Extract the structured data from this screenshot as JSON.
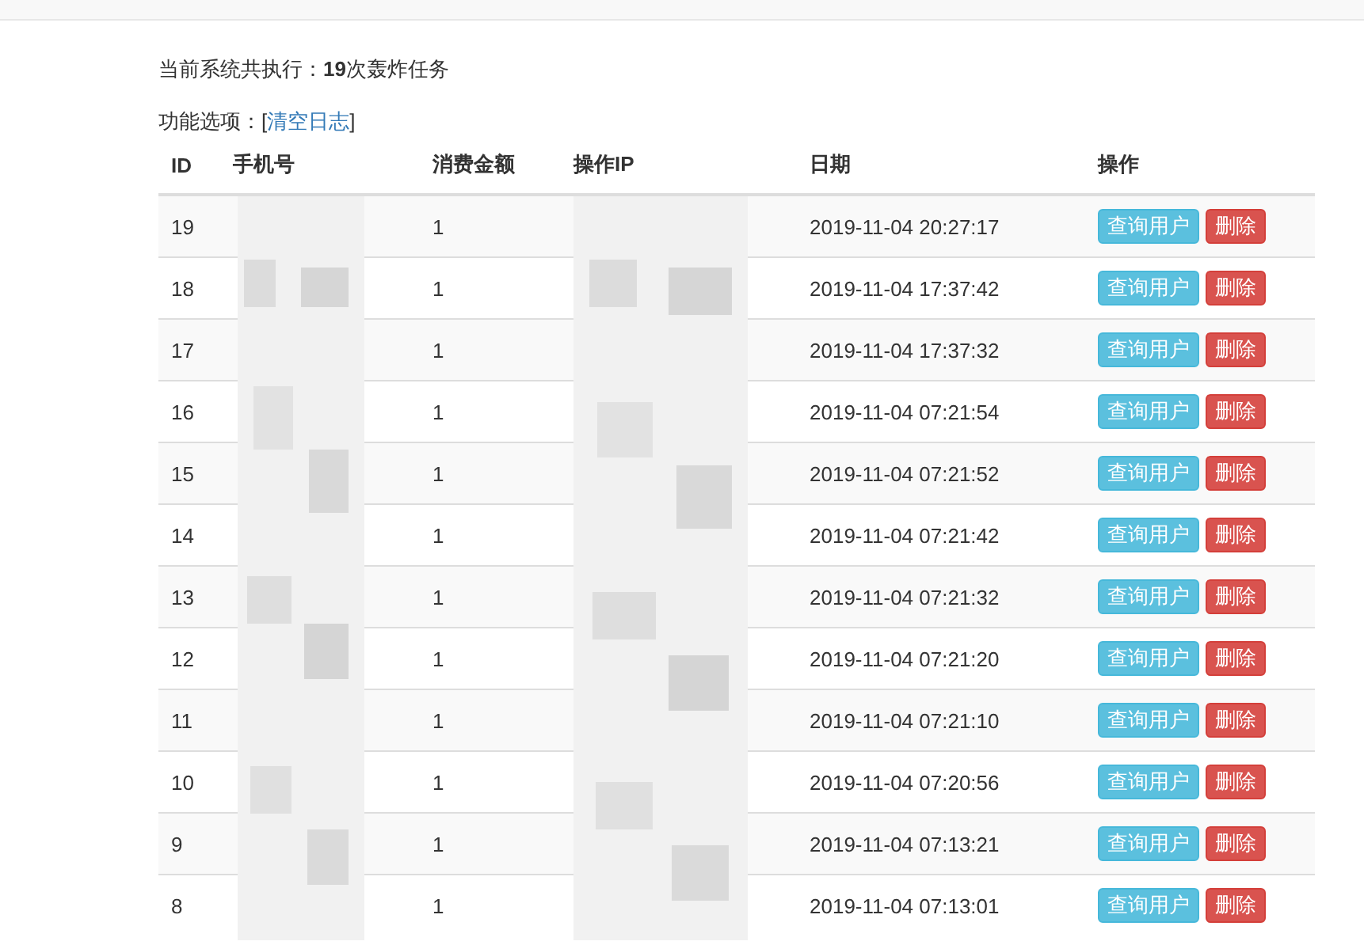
{
  "summary": {
    "prefix": "当前系统共执行：",
    "count": "19",
    "suffix": "次轰炸任务"
  },
  "options": {
    "label": "功能选项：[",
    "link": "清空日志",
    "close": "]"
  },
  "table": {
    "columns": [
      "ID",
      "手机号",
      "消费金额",
      "操作IP",
      "日期",
      "操作"
    ],
    "rows": [
      {
        "id": "19",
        "amount": "1",
        "date": "2019-11-04 20:27:17",
        "actions": [
          {
            "label": "查询用户",
            "kind": "info"
          },
          {
            "label": "删除",
            "kind": "danger"
          }
        ]
      },
      {
        "id": "18",
        "amount": "1",
        "date": "2019-11-04 17:37:42",
        "actions": [
          {
            "label": "查询用户",
            "kind": "info"
          },
          {
            "label": "删除",
            "kind": "danger"
          }
        ]
      },
      {
        "id": "17",
        "amount": "1",
        "date": "2019-11-04 17:37:32",
        "actions": [
          {
            "label": "查询用户",
            "kind": "info"
          },
          {
            "label": "删除",
            "kind": "danger"
          }
        ]
      },
      {
        "id": "16",
        "amount": "1",
        "date": "2019-11-04 07:21:54",
        "actions": [
          {
            "label": "查询用户",
            "kind": "info"
          },
          {
            "label": "删除",
            "kind": "danger"
          }
        ]
      },
      {
        "id": "15",
        "amount": "1",
        "date": "2019-11-04 07:21:52",
        "actions": [
          {
            "label": "查询用户",
            "kind": "info"
          },
          {
            "label": "删除",
            "kind": "danger"
          }
        ]
      },
      {
        "id": "14",
        "amount": "1",
        "date": "2019-11-04 07:21:42",
        "actions": [
          {
            "label": "查询用户",
            "kind": "info"
          },
          {
            "label": "删除",
            "kind": "danger"
          }
        ]
      },
      {
        "id": "13",
        "amount": "1",
        "date": "2019-11-04 07:21:32",
        "actions": [
          {
            "label": "查询用户",
            "kind": "info"
          },
          {
            "label": "删除",
            "kind": "danger"
          }
        ]
      },
      {
        "id": "12",
        "amount": "1",
        "date": "2019-11-04 07:21:20",
        "actions": [
          {
            "label": "查询用户",
            "kind": "info"
          },
          {
            "label": "删除",
            "kind": "danger"
          }
        ]
      },
      {
        "id": "11",
        "amount": "1",
        "date": "2019-11-04 07:21:10",
        "actions": [
          {
            "label": "查询用户",
            "kind": "info"
          },
          {
            "label": "删除",
            "kind": "danger"
          }
        ]
      },
      {
        "id": "10",
        "amount": "1",
        "date": "2019-11-04 07:20:56",
        "actions": [
          {
            "label": "查询用户",
            "kind": "info"
          },
          {
            "label": "删除",
            "kind": "danger"
          }
        ]
      },
      {
        "id": "9",
        "amount": "1",
        "date": "2019-11-04 07:13:21",
        "actions": [
          {
            "label": "查询用户",
            "kind": "info"
          },
          {
            "label": "删除",
            "kind": "danger"
          }
        ]
      },
      {
        "id": "8",
        "amount": "1",
        "date": "2019-11-04 07:13:01",
        "actions": [
          {
            "label": "查询用户",
            "kind": "info"
          },
          {
            "label": "删除",
            "kind": "danger"
          }
        ]
      }
    ]
  }
}
